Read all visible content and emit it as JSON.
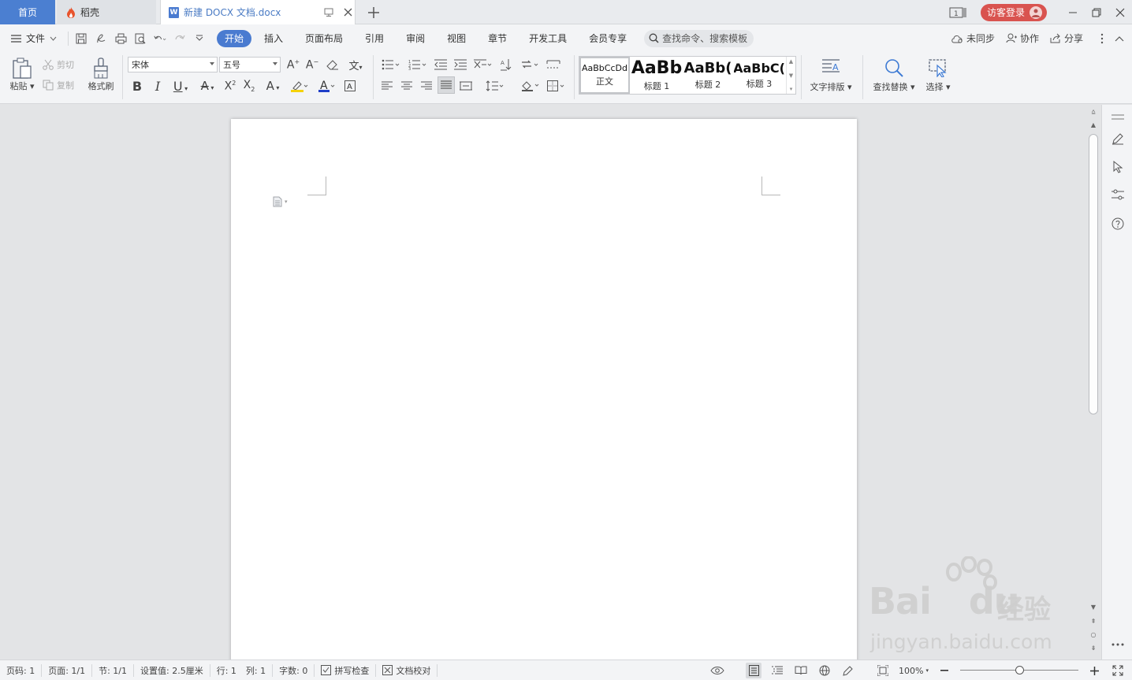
{
  "titlebar": {
    "tabs": {
      "home": "首页",
      "daoke": "稻壳",
      "doc": "新建 DOCX 文档.docx"
    },
    "login": "访客登录"
  },
  "menubar": {
    "file": "文件",
    "tabs": [
      "开始",
      "插入",
      "页面布局",
      "引用",
      "审阅",
      "视图",
      "章节",
      "开发工具",
      "会员专享"
    ],
    "active_tab": "开始",
    "search_placeholder": "查找命令、搜索模板",
    "right": {
      "sync": "未同步",
      "collab": "协作",
      "share": "分享"
    }
  },
  "ribbon": {
    "paste": "粘贴",
    "cut": "剪切",
    "copy": "复制",
    "format_painter": "格式刷",
    "font_name": "宋体",
    "font_size": "五号",
    "styles": [
      {
        "sample": "AaBbCcDd",
        "name": "正文"
      },
      {
        "sample": "AaBb",
        "name": "标题 1"
      },
      {
        "sample": "AaBb(",
        "name": "标题 2"
      },
      {
        "sample": "AaBbC(",
        "name": "标题 3"
      }
    ],
    "text_layout": "文字排版",
    "find_replace": "查找替换",
    "select": "选择"
  },
  "statusbar": {
    "page_num": "页码: 1",
    "pages": "页面: 1/1",
    "section": "节: 1/1",
    "setting": "设置值: 2.5厘米",
    "row": "行: 1",
    "col": "列: 1",
    "word_count": "字数: 0",
    "spell_check": "拼写检查",
    "doc_proof": "文档校对",
    "zoom": "100%",
    "zoom_fraction": 0.5
  },
  "watermark": {
    "brand": "Bai",
    "brand_suffix": "du",
    "brand_cn": "经验",
    "url": "jingyan.baidu.com"
  },
  "colors": {
    "accent": "#4a7bd0",
    "login": "#d9534f",
    "home_tab": "#4b7fd1"
  }
}
